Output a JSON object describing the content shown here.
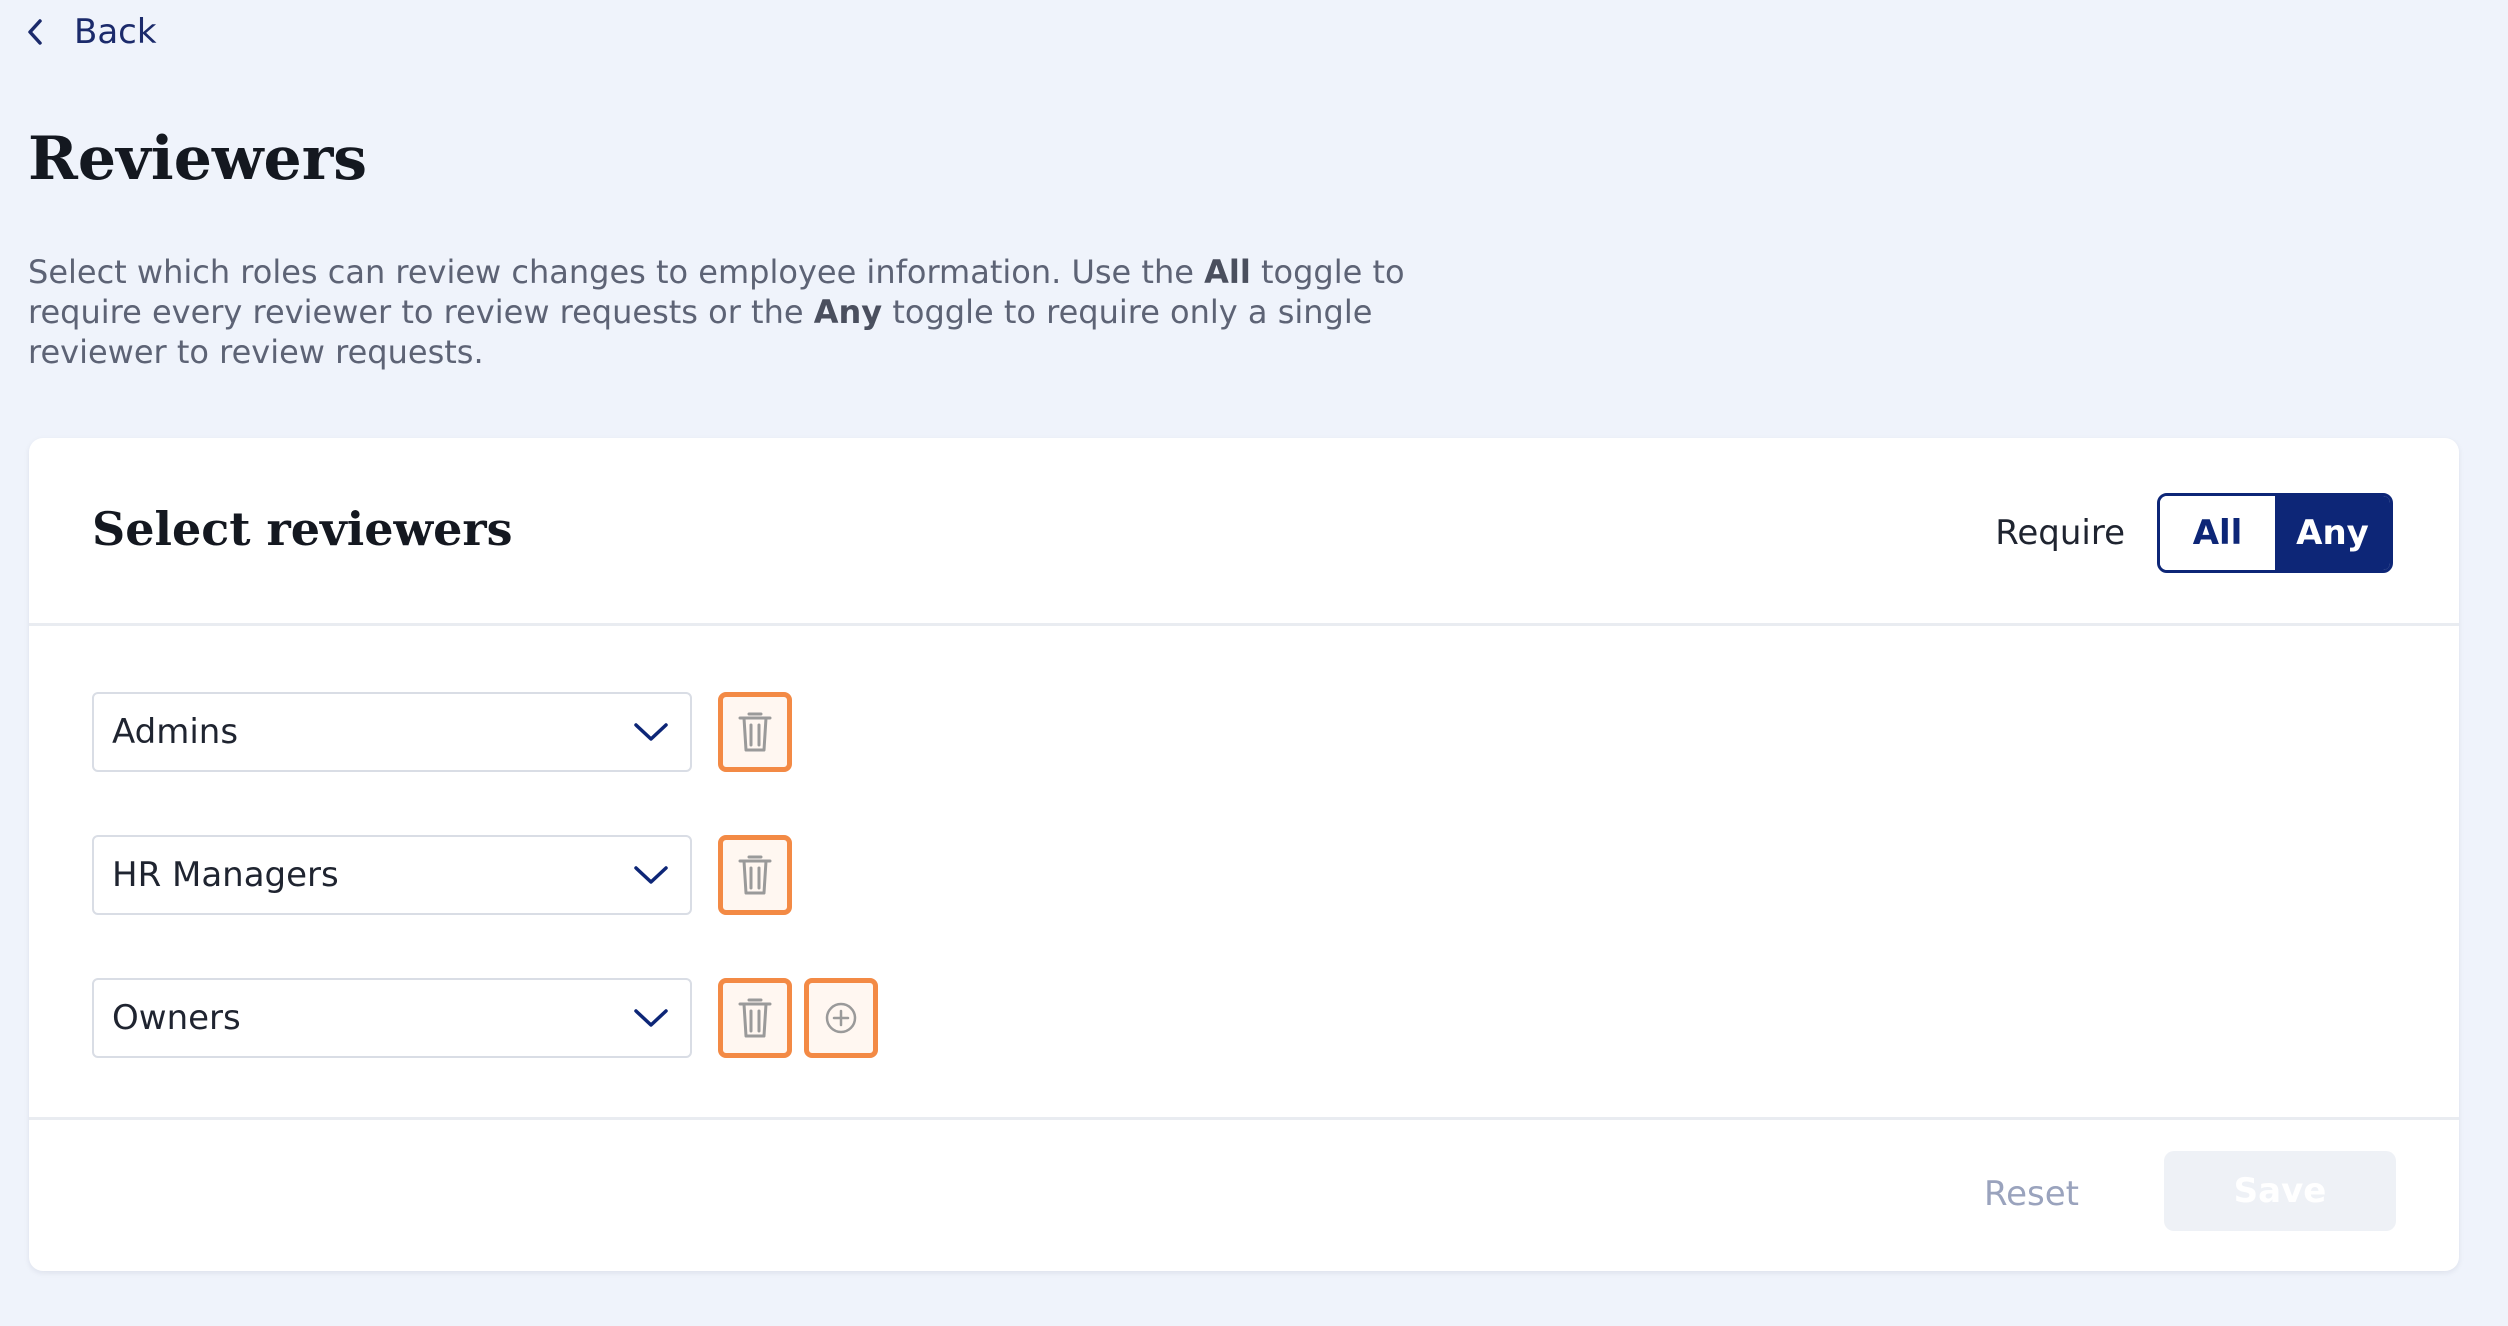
{
  "nav": {
    "back_label": "Back"
  },
  "page": {
    "title": "Reviewers",
    "description": {
      "part1": "Select which roles can review changes to employee information. Use the ",
      "all_word": "All",
      "part2": " toggle to require every reviewer to review requests or the ",
      "any_word": "Any",
      "part3": " toggle to require only a single reviewer to review requests."
    }
  },
  "card": {
    "title": "Select reviewers",
    "require_label": "Require",
    "toggle": {
      "all": "All",
      "any": "Any",
      "selected": "Any"
    },
    "reviewers": [
      {
        "value": "Admins"
      },
      {
        "value": "HR Managers"
      },
      {
        "value": "Owners"
      }
    ],
    "footer": {
      "reset_label": "Reset",
      "save_label": "Save"
    }
  },
  "colors": {
    "accent": "#0d2677",
    "highlight": "#f38a45",
    "background": "#eff3fb"
  }
}
